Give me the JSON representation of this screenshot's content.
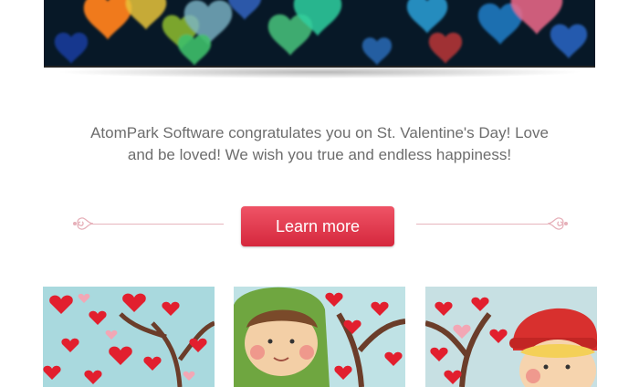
{
  "hero": {
    "image": "valentine-bokeh-hearts-banner"
  },
  "message": {
    "line1": "AtomPark Software congratulates you on St. Valentine's Day! Love",
    "line2": "and be loved! We wish you true and endless happiness!"
  },
  "cta": {
    "label": "Learn more"
  },
  "cards": [
    {
      "image": "hearts-tree-illustration"
    },
    {
      "image": "boy-green-hood-illustration"
    },
    {
      "image": "girl-red-hat-illustration"
    }
  ],
  "colors": {
    "accent": "#e03346",
    "text": "#6d6d6d",
    "divider": "#e7b5bd"
  }
}
